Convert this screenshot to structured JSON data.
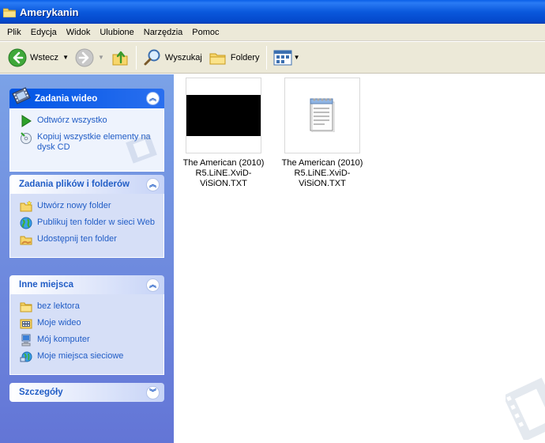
{
  "window": {
    "title": "Amerykanin"
  },
  "menu": [
    "Plik",
    "Edycja",
    "Widok",
    "Ulubione",
    "Narzędzia",
    "Pomoc"
  ],
  "toolbar": {
    "back": "Wstecz",
    "search": "Wyszukaj",
    "folders": "Foldery"
  },
  "taskpane": {
    "video_tasks": {
      "title": "Zadania wideo",
      "items": [
        "Odtwórz wszystko",
        "Kopiuj wszystkie elementy na dysk CD"
      ]
    },
    "file_tasks": {
      "title": "Zadania plików i folderów",
      "items": [
        "Utwórz nowy folder",
        "Publikuj ten folder w sieci Web",
        "Udostępnij ten folder"
      ]
    },
    "other_places": {
      "title": "Inne miejsca",
      "items": [
        "bez lektora",
        "Moje wideo",
        "Mój komputer",
        "Moje miejsca sieciowe"
      ]
    },
    "details": {
      "title": "Szczegóły"
    }
  },
  "files": [
    {
      "name_line1": "The American (2010)",
      "name_line2": "R5.LiNE.XviD-ViSiON.TXT",
      "icon": "video-thumbnail"
    },
    {
      "name_line1": "The American (2010)",
      "name_line2": "R5.LiNE.XviD-ViSiON.TXT",
      "icon": "notepad-icon"
    }
  ]
}
